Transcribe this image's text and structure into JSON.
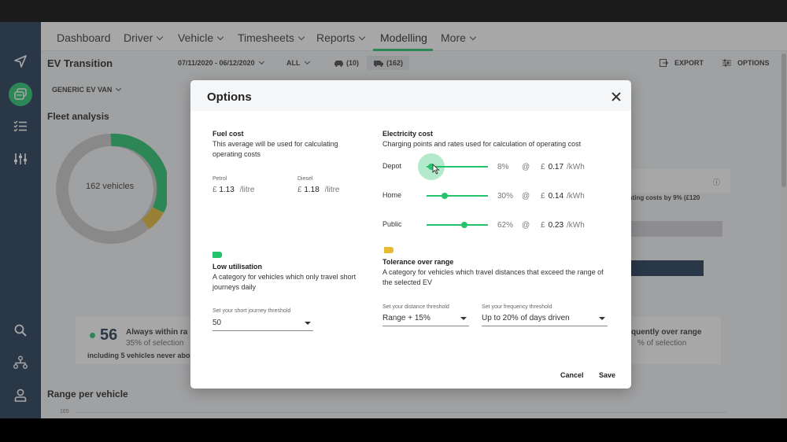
{
  "colors": {
    "sidebar": "#1d3350",
    "accent": "#22c36b",
    "warning": "#e8b931"
  },
  "sidebar": {
    "items": [
      {
        "icon": "navigation-arrow-icon"
      },
      {
        "icon": "vehicles-icon"
      },
      {
        "icon": "task-list-icon"
      },
      {
        "icon": "sliders-icon"
      },
      {
        "icon": "search-icon"
      },
      {
        "icon": "network-icon"
      },
      {
        "icon": "user-icon"
      }
    ]
  },
  "nav": {
    "dashboard": "Dashboard",
    "driver": "Driver",
    "vehicle": "Vehicle",
    "timesheets": "Timesheets",
    "reports": "Reports",
    "modelling": "Modelling",
    "more": "More"
  },
  "page": {
    "title": "EV Transition",
    "date_range": "07/11/2020 - 06/12/2020",
    "filter_all": "ALL",
    "car_count": "(10)",
    "van_count": "(162)",
    "export": "EXPORT",
    "options": "OPTIONS",
    "ev_model": "GENERIC EV VAN",
    "fleet_analysis": "Fleet analysis",
    "donut_label": "162 vehicles",
    "savings_text": "rating costs by 9% (£120",
    "stat_number": "56",
    "stat_label": "Always within ra",
    "stat_sub": "35% of selection",
    "stat_note": "including 5 vehicles never abo",
    "freq_label": "quently over range",
    "freq_sub": "% of selection",
    "range_title": "Range per vehicle",
    "axis_tick": "165"
  },
  "modal": {
    "title": "Options",
    "fuel": {
      "heading": "Fuel cost",
      "desc1": "This average will be used for calculating",
      "desc2": "operating costs",
      "petrol_label": "Petrol",
      "petrol_currency": "£",
      "petrol_value": "1.13",
      "petrol_unit": "/litre",
      "diesel_label": "Diesel",
      "diesel_currency": "£",
      "diesel_value": "1.18",
      "diesel_unit": "/litre"
    },
    "electricity": {
      "heading": "Electricity cost",
      "desc": "Charging points and rates used for calculation of operating cost",
      "rows": [
        {
          "label": "Depot",
          "percent_value": 0.08,
          "percent": "8%",
          "at": "@",
          "currency": "£",
          "rate": "0.17",
          "unit": "/kWh"
        },
        {
          "label": "Home",
          "percent_value": 0.3,
          "percent": "30%",
          "at": "@",
          "currency": "£",
          "rate": "0.14",
          "unit": "/kWh"
        },
        {
          "label": "Public",
          "percent_value": 0.62,
          "percent": "62%",
          "at": "@",
          "currency": "£",
          "rate": "0.23",
          "unit": "/kWh"
        }
      ]
    },
    "low_util": {
      "heading": "Low utilisation",
      "desc1": "A category for vehicles which only travel short",
      "desc2": "journeys daily",
      "field_label": "Set your short journey threshold",
      "field_value": "50"
    },
    "tolerance": {
      "heading": "Tolerance over range",
      "desc1": "A category for vehicles which travel distances that exceed the range of",
      "desc2": "the selected EV",
      "distance_label": "Set your distance threshold",
      "distance_value": "Range + 15%",
      "frequency_label": "Set your frequency threshold",
      "frequency_value": "Up to 20% of days driven"
    },
    "cancel": "Cancel",
    "save": "Save"
  }
}
